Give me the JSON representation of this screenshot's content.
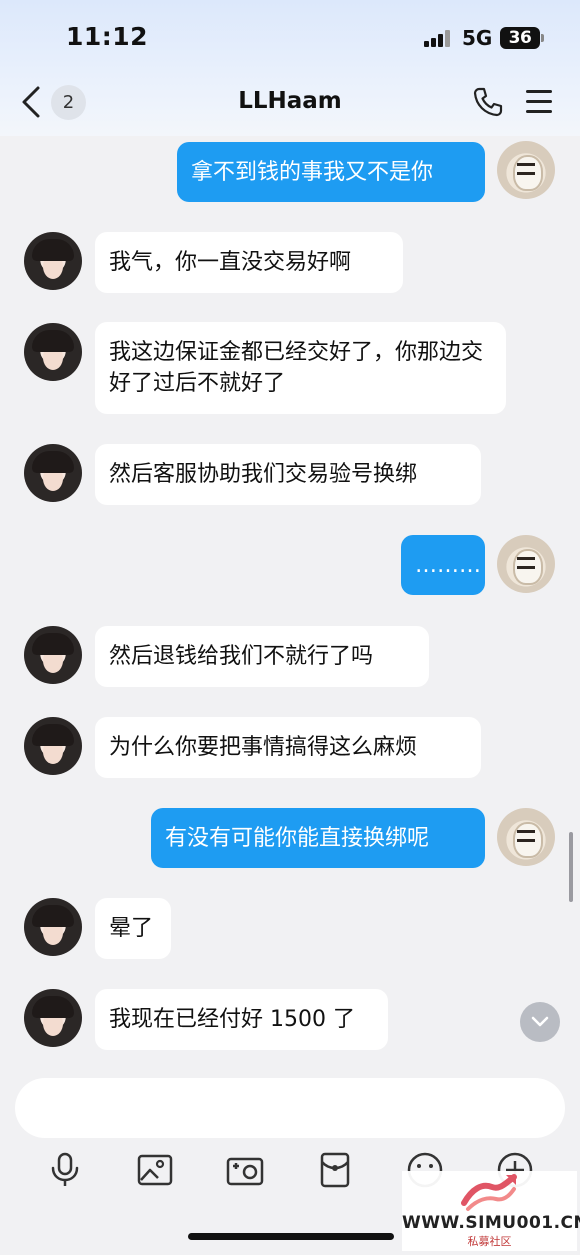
{
  "status_bar": {
    "time": "11:12",
    "network": "5G",
    "battery": "36"
  },
  "nav": {
    "unread_count": "2",
    "title": "LLHaam"
  },
  "messages": [
    {
      "side": "out",
      "text": "拿不到钱的事我又不是你"
    },
    {
      "side": "in",
      "text": "我气，你一直没交易好啊"
    },
    {
      "side": "in",
      "text": "我这边保证金都已经交好了，你那边交好了过后不就好了"
    },
    {
      "side": "in",
      "text": "然后客服协助我们交易验号换绑"
    },
    {
      "side": "out",
      "text": "………"
    },
    {
      "side": "in",
      "text": "然后退钱给我们不就行了吗"
    },
    {
      "side": "in",
      "text": "为什么你要把事情搞得这么麻烦"
    },
    {
      "side": "out",
      "text": "有没有可能你能直接换绑呢"
    },
    {
      "side": "in",
      "text": "晕了"
    },
    {
      "side": "in",
      "text": "我现在已经付好 1500 了"
    }
  ],
  "input": {
    "value": "",
    "placeholder": ""
  },
  "toolbar": [
    "microphone-icon",
    "image-icon",
    "camera-icon",
    "red-packet-icon",
    "emoji-icon",
    "plus-icon"
  ],
  "watermark": {
    "domain": "WWW.SIMU001.CN",
    "subtitle": "私募社区"
  },
  "colors": {
    "outgoing_bubble": "#1e9cf2",
    "incoming_bubble": "#ffffff",
    "background": "#f1f1f3"
  }
}
